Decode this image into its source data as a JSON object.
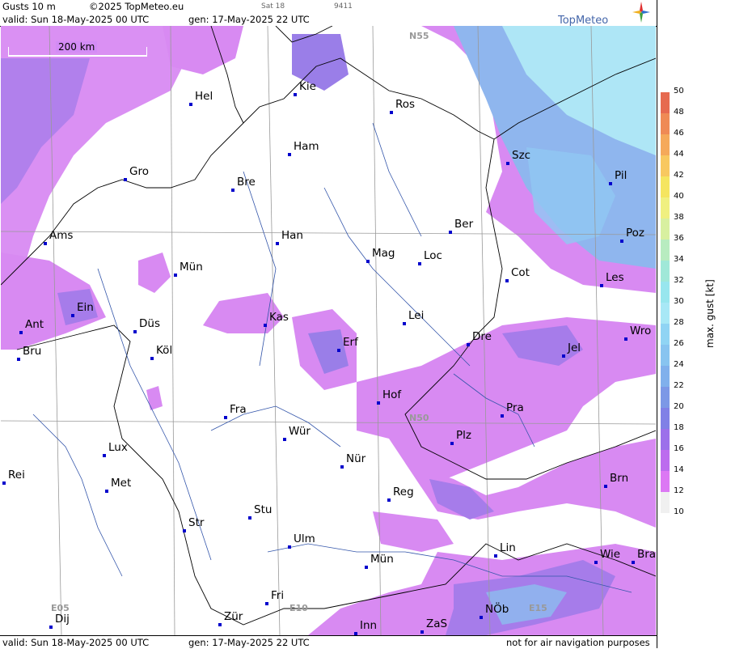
{
  "header": {
    "product": "Gusts 10 m",
    "copyright": "©2025 TopMeteo.eu",
    "sat": "Sat 18",
    "code": "9411",
    "valid": "valid:  Sun  18-May-2025  00 UTC",
    "gen": "gen: 17-May-2025 22 UTC",
    "brand": "TopMeteo"
  },
  "footer": {
    "valid": "valid:  Sun  18-May-2025  00 UTC",
    "gen": "gen: 17-May-2025 22 UTC",
    "note": "not for air navigation purposes"
  },
  "scale": {
    "label": "200 km"
  },
  "grid_labels": [
    "N55",
    "N50",
    "E05",
    "E10",
    "E15"
  ],
  "cities": [
    {
      "name": "Hel"
    },
    {
      "name": "Kie"
    },
    {
      "name": "Ros"
    },
    {
      "name": "Ham"
    },
    {
      "name": "Szc"
    },
    {
      "name": "Gro"
    },
    {
      "name": "Bre"
    },
    {
      "name": "Pil"
    },
    {
      "name": "Ber"
    },
    {
      "name": "Ams"
    },
    {
      "name": "Han"
    },
    {
      "name": "Poz"
    },
    {
      "name": "Mag"
    },
    {
      "name": "Loc"
    },
    {
      "name": "Mün"
    },
    {
      "name": "Cot"
    },
    {
      "name": "Les"
    },
    {
      "name": "Ein"
    },
    {
      "name": "Kas"
    },
    {
      "name": "Lei"
    },
    {
      "name": "Ant"
    },
    {
      "name": "Düs"
    },
    {
      "name": "Wro"
    },
    {
      "name": "Erf"
    },
    {
      "name": "Dre"
    },
    {
      "name": "Bru"
    },
    {
      "name": "Köl"
    },
    {
      "name": "Jel"
    },
    {
      "name": "Hof"
    },
    {
      "name": "Fra"
    },
    {
      "name": "Pra"
    },
    {
      "name": "Wür"
    },
    {
      "name": "Plz"
    },
    {
      "name": "Lux"
    },
    {
      "name": "Nür"
    },
    {
      "name": "Rei"
    },
    {
      "name": "Brn"
    },
    {
      "name": "Met"
    },
    {
      "name": "Reg"
    },
    {
      "name": "Stu"
    },
    {
      "name": "Str"
    },
    {
      "name": "Ulm"
    },
    {
      "name": "Lin"
    },
    {
      "name": "Mün"
    },
    {
      "name": "Wie"
    },
    {
      "name": "Bra"
    },
    {
      "name": "Fri"
    },
    {
      "name": "NÖb"
    },
    {
      "name": "Dij"
    },
    {
      "name": "Zür"
    },
    {
      "name": "Inn"
    },
    {
      "name": "ZaS"
    }
  ],
  "legend": {
    "title": "max. gust  [kt]",
    "ticks": [
      "50",
      "48",
      "46",
      "44",
      "42",
      "40",
      "38",
      "36",
      "34",
      "32",
      "30",
      "28",
      "26",
      "24",
      "22",
      "20",
      "18",
      "16",
      "14",
      "12",
      "10"
    ],
    "colors": [
      "#e66a50",
      "#ef8a55",
      "#f5a95a",
      "#f8c860",
      "#f5e560",
      "#f0f080",
      "#d8f0a0",
      "#b8ecc0",
      "#a0e8d8",
      "#98e6ee",
      "#a8e8f6",
      "#90d4f4",
      "#88c4f0",
      "#80b0ec",
      "#7c98e6",
      "#8080e6",
      "#9c70ea",
      "#bc6cee",
      "#dc78f4",
      "#f0f0f0"
    ]
  }
}
